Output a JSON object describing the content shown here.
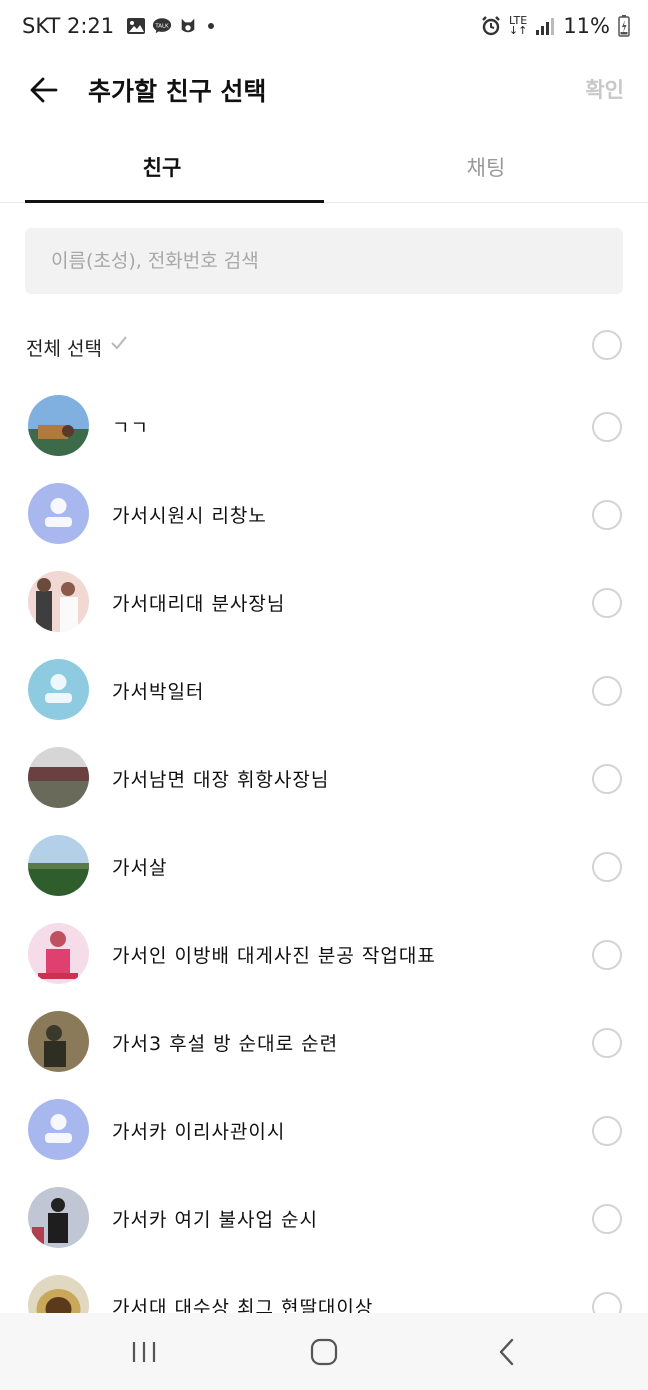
{
  "status_bar": {
    "carrier_time": "SKT 2:21",
    "network": "LTE",
    "battery": "11%"
  },
  "header": {
    "title": "추가할 친구 선택",
    "confirm_label": "확인"
  },
  "tabs": [
    {
      "label": "친구",
      "active": true
    },
    {
      "label": "채팅",
      "active": false
    }
  ],
  "search": {
    "placeholder": "이름(초성), 전화번호 검색",
    "value": ""
  },
  "select_all": {
    "label": "전체 선택"
  },
  "friends": [
    {
      "name": "ㄱㄱ",
      "avatar": "photo-landscape",
      "avatar_colors": [
        "#6fa3d8",
        "#3c6a4a"
      ]
    },
    {
      "name": "가서시원시 리창노",
      "avatar": "default-person",
      "avatar_colors": [
        "#a8b8ee",
        "#ffffff"
      ]
    },
    {
      "name": "가서대리대 분사장님",
      "avatar": "photo-couple",
      "avatar_colors": [
        "#f1d3cf",
        "#4a4a4a"
      ]
    },
    {
      "name": "가서박일터",
      "avatar": "default-person",
      "avatar_colors": [
        "#8fcbe0",
        "#ffffff"
      ]
    },
    {
      "name": "가서남면 대장 휘항사장님",
      "avatar": "photo-building",
      "avatar_colors": [
        "#c9c9c9",
        "#5a5a5a"
      ]
    },
    {
      "name": "가서살",
      "avatar": "photo-field",
      "avatar_colors": [
        "#a9c7e0",
        "#2e5a2a"
      ]
    },
    {
      "name": "가서인 이방배 대게사진 분공 작업대표",
      "avatar": "photo-poster",
      "avatar_colors": [
        "#f6d7e4",
        "#d04060"
      ]
    },
    {
      "name": "가서3 후설 방 순대로 순련",
      "avatar": "photo-person",
      "avatar_colors": [
        "#8b7a5a",
        "#3a3a2a"
      ]
    },
    {
      "name": "가서카 이리사관이시",
      "avatar": "default-person",
      "avatar_colors": [
        "#a8b8ee",
        "#ffffff"
      ]
    },
    {
      "name": "가서카 여기 불사업 순시",
      "avatar": "photo-crowd",
      "avatar_colors": [
        "#b8c0d0",
        "#2a2a2a"
      ]
    },
    {
      "name": "가서대 대수상 최그 현딸대이상",
      "avatar": "photo-cake",
      "avatar_colors": [
        "#c9b27a",
        "#5a3a1a"
      ]
    }
  ]
}
